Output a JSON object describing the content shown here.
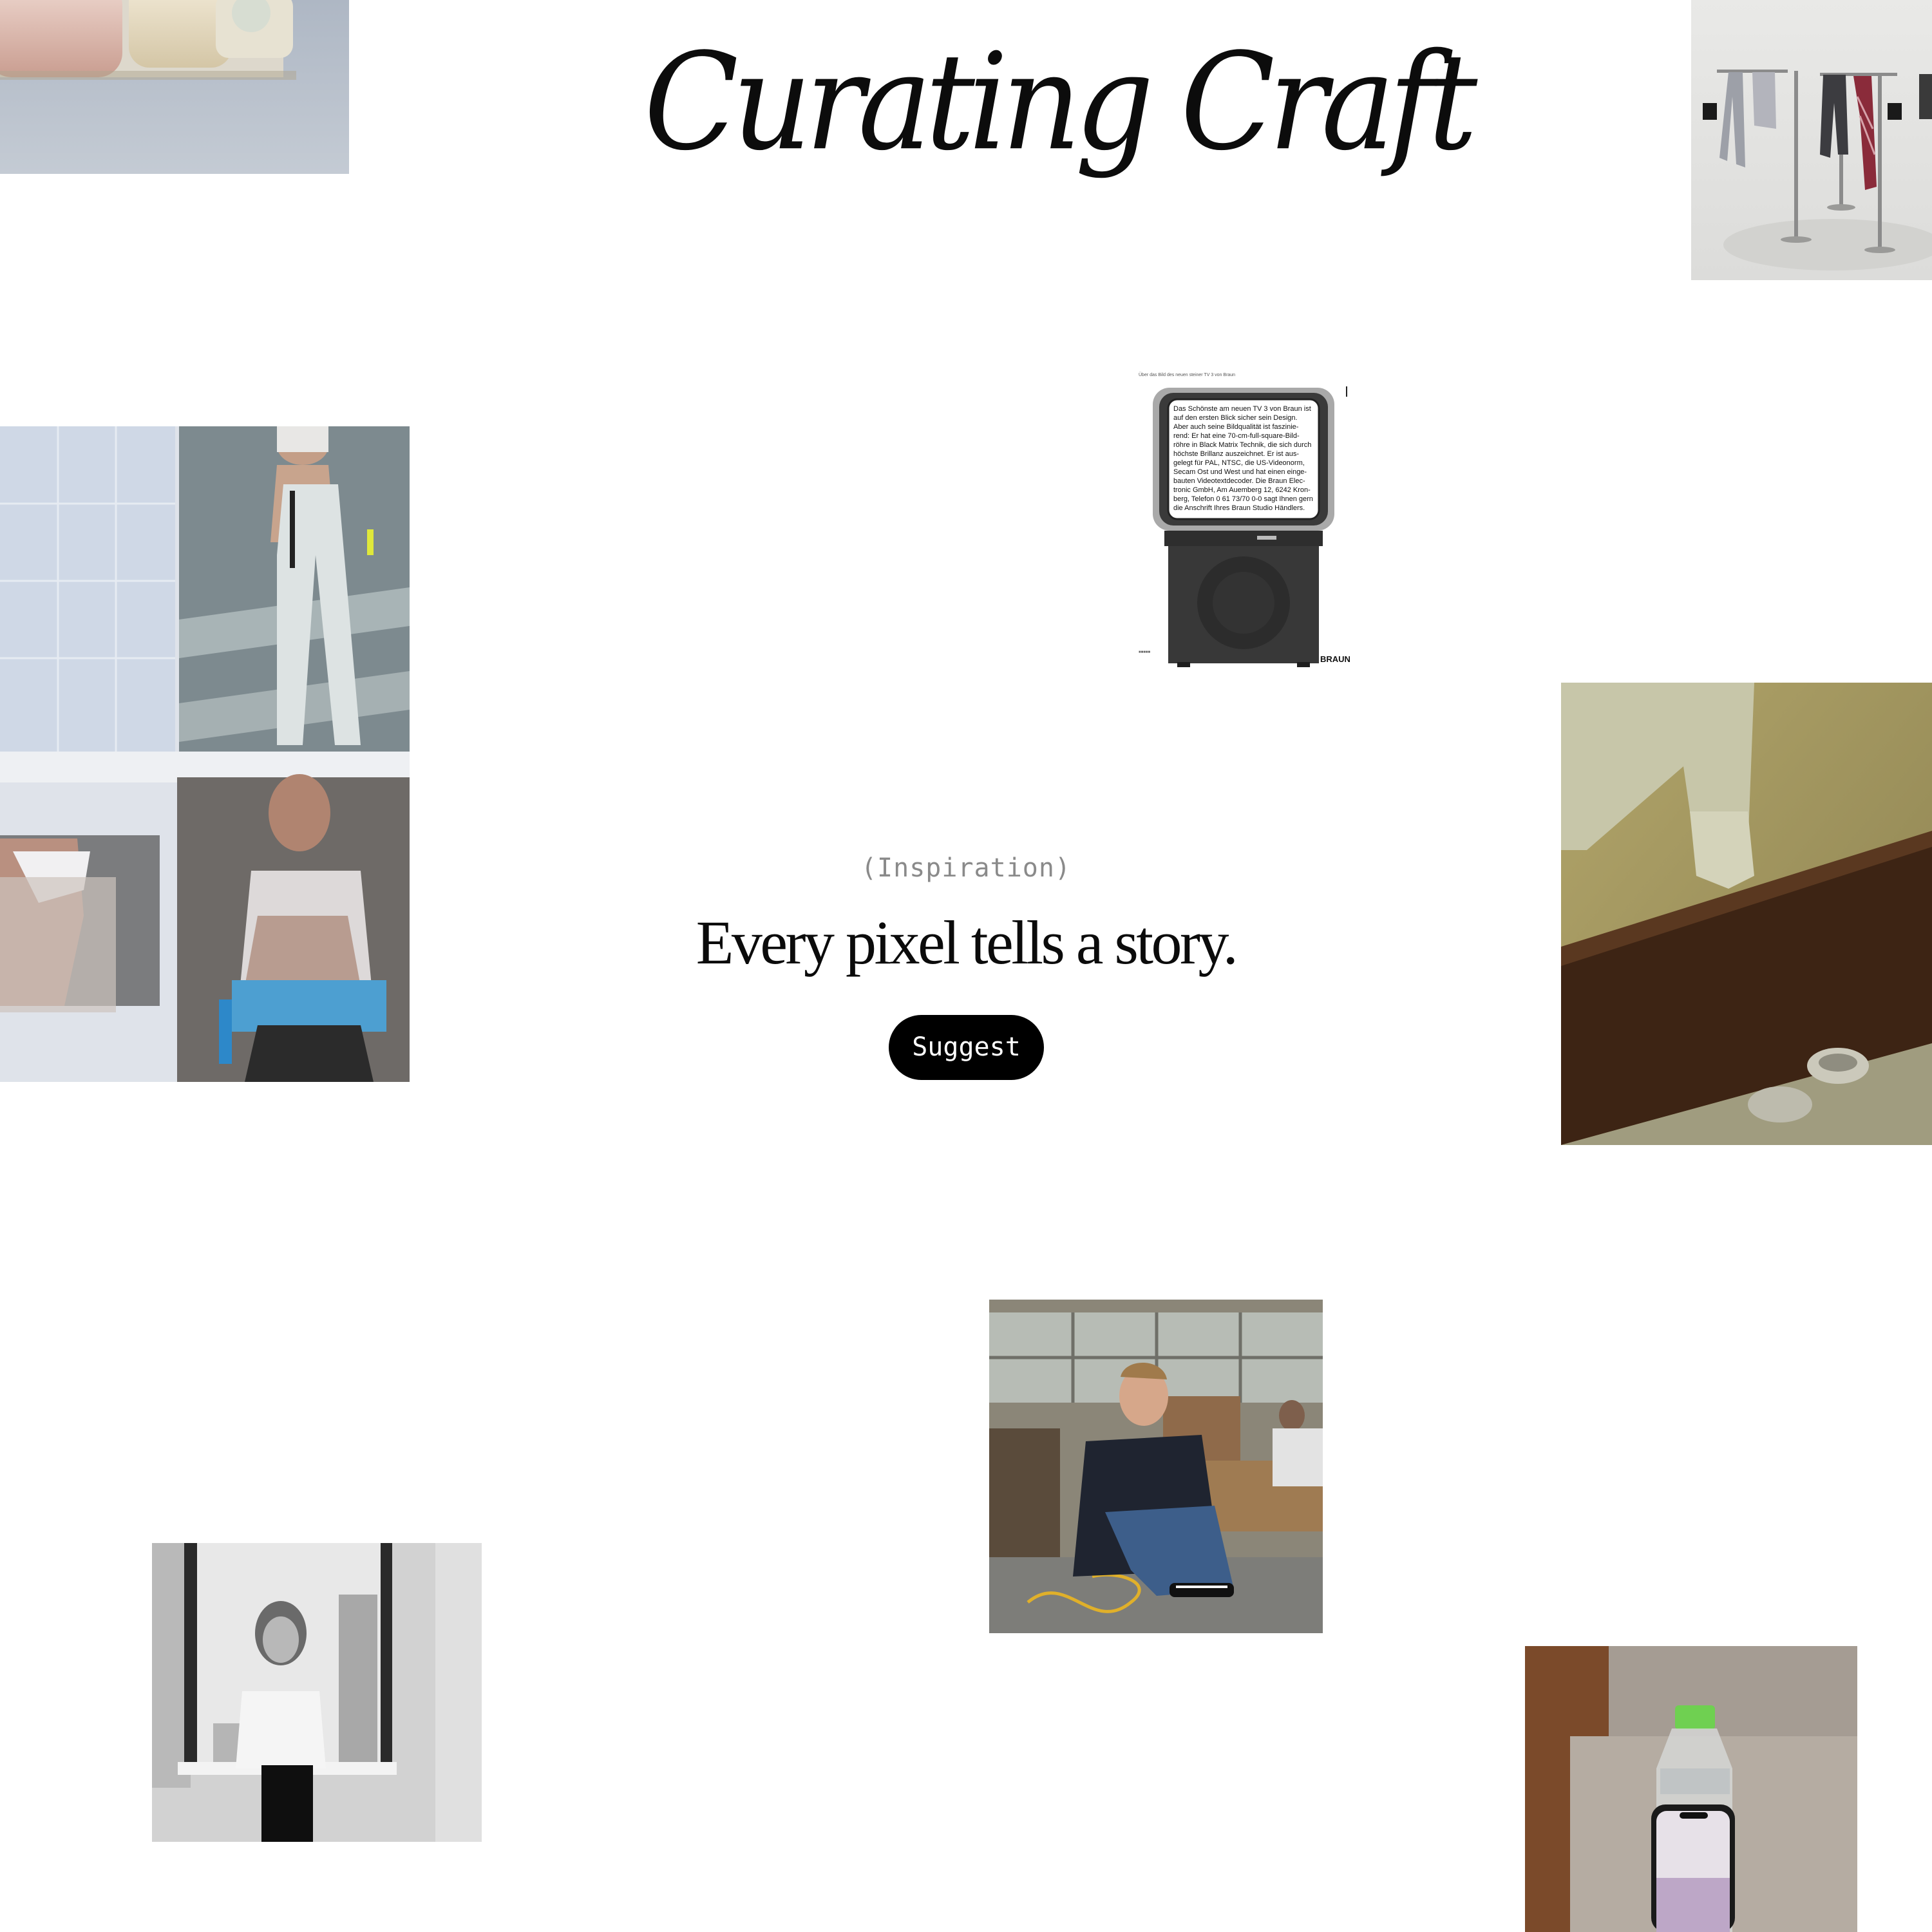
{
  "header": {
    "title": "Curating Craft"
  },
  "hero": {
    "eyebrow": "(Inspiration)",
    "headline": "Every pixel tells a story.",
    "cta_label": "Suggest"
  },
  "tiles": [
    {
      "name": "tile-product-cases",
      "subject": "pastel product cases"
    },
    {
      "name": "tile-clothing-racks",
      "subject": "clothing on metal racks"
    },
    {
      "name": "tile-runway-collage",
      "subject": "runway fashion collage"
    },
    {
      "name": "tile-braun-tv-ad",
      "subject": "Braun TV 3 advertisement"
    },
    {
      "name": "tile-tatami-slippers",
      "subject": "tatami floor with slippers"
    },
    {
      "name": "tile-office-portrait",
      "subject": "man seated on office floor"
    },
    {
      "name": "tile-window-portrait",
      "subject": "black and white portrait at window"
    },
    {
      "name": "tile-bottle-phone",
      "subject": "water bottle and phone"
    }
  ],
  "braun_ad": {
    "caption": "Über das Bild des neuen steiner TV 3 von Braun",
    "screen_text": [
      "Das Schönste am neuen TV 3 von Braun ist",
      "auf den ersten Blick sicher sein Design.",
      "Aber auch seine Bildqualität ist faszinie-",
      "rend: Er hat eine 70-cm-full-square-Bild-",
      "röhre in Black Matrix Technik, die sich durch",
      "höchste Brillanz auszeichnet. Er ist aus-",
      "gelegt für PAL, NTSC, die US-Videonorm,",
      "Secam Ost und West und hat einen einge-",
      "bauten Videotextdecoder. Die Braun Elec-",
      "tronic GmbH, Am Auemberg 12, 6242 Kron-",
      "berg, Telefon 0 61 73/70 0-0 sagt Ihnen gern",
      "die Anschrift Ihres Braun Studio Händlers."
    ],
    "brand": "BRAUN"
  },
  "colors": {
    "background": "#ffffff",
    "text": "#0b0b0b",
    "muted": "#8a8a8a",
    "button_bg": "#000000",
    "button_text": "#ffffff"
  }
}
